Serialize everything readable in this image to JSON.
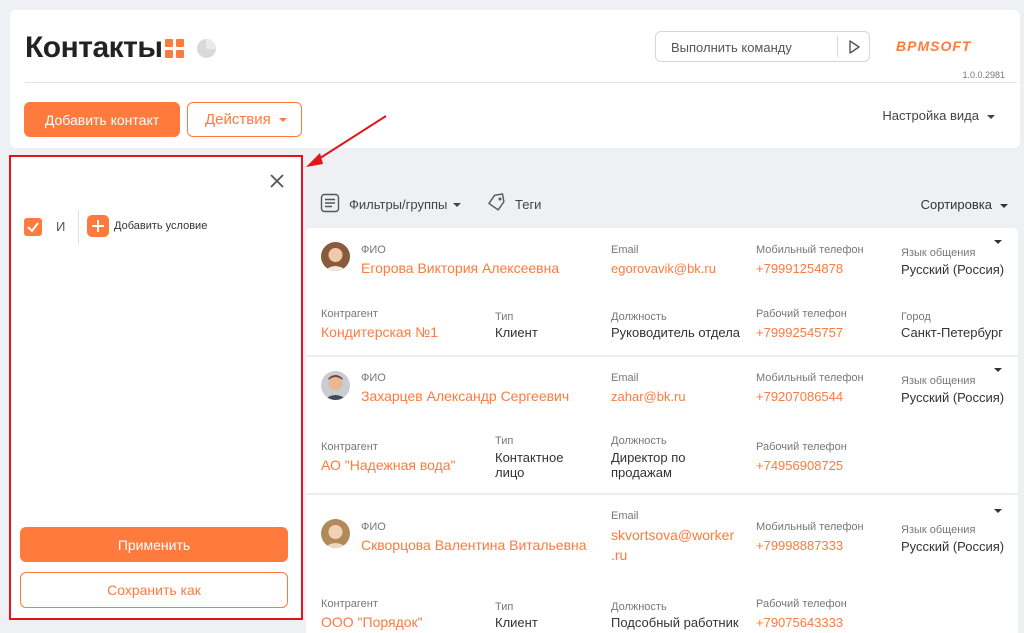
{
  "header": {
    "title": "Контакты",
    "command_placeholder": "Выполнить команду",
    "logo_text": "BPMSOFT",
    "version": "1.0.0.2981",
    "add_contact_label": "Добавить контакт",
    "actions_label": "Действия",
    "view_settings_label": "Настройка вида"
  },
  "colors": {
    "accent": "#ff7a3d",
    "highlight": "#e2151c"
  },
  "filter_panel": {
    "logic_label": "И",
    "add_condition_label": "Добавить условие",
    "apply_label": "Применить",
    "save_as_label": "Сохранить как"
  },
  "toolbar": {
    "filters_label": "Фильтры/группы",
    "tags_label": "Теги",
    "sort_label": "Сортировка"
  },
  "field_labels": {
    "name": "ФИО",
    "email": "Email",
    "mobile": "Мобильный телефон",
    "language": "Язык общения",
    "account": "Контрагент",
    "type": "Тип",
    "position": "Должность",
    "work_phone": "Рабочий телефон",
    "city": "Город"
  },
  "contacts": [
    {
      "name": "Егорова Виктория Алексеевна",
      "email": "egorovavik@bk.ru",
      "mobile": "+79991254878",
      "language": "Русский (Россия)",
      "account": "Кондитерская №1",
      "type": "Клиент",
      "position": "Руководитель отдела",
      "work_phone": "+79992545757",
      "city": "Санкт-Петербург"
    },
    {
      "name": "Захарцев Александр Сергеевич",
      "email": "zahar@bk.ru",
      "mobile": "+79207086544",
      "language": "Русский (Россия)",
      "account": "АО \"Надежная вода\"",
      "type_line1": "Контактное",
      "type_line2": "лицо",
      "position_line1": "Директор по",
      "position_line2": "продажам",
      "work_phone": "+74956908725"
    },
    {
      "name": "Скворцова Валентина Витальевна",
      "email_line1": "skvortsova@worker",
      "email_line2": ".ru",
      "mobile": "+79998887333",
      "language": "Русский (Россия)",
      "account": "ООО \"Порядок\"",
      "type": "Клиент",
      "position": "Подсобный работник",
      "work_phone": "+79075643333"
    }
  ]
}
